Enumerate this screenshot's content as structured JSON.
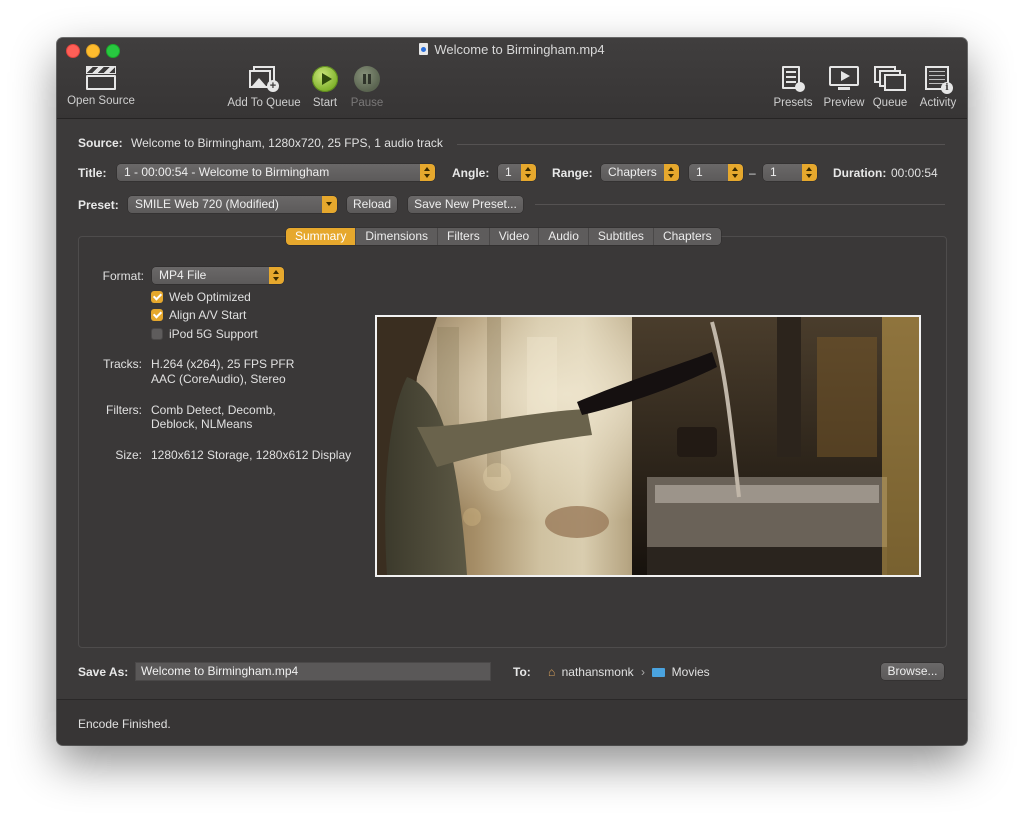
{
  "window": {
    "title": "Welcome to Birmingham.mp4"
  },
  "toolbar": {
    "open_source": "Open Source",
    "add_to_queue": "Add To Queue",
    "start": "Start",
    "pause": "Pause",
    "presets": "Presets",
    "preview": "Preview",
    "queue": "Queue",
    "activity": "Activity"
  },
  "source": {
    "label": "Source:",
    "value": "Welcome to Birmingham, 1280x720, 25 FPS, 1 audio track"
  },
  "title_row": {
    "title_label": "Title:",
    "title_value": "1 - 00:00:54 - Welcome to Birmingham",
    "angle_label": "Angle:",
    "angle_value": "1",
    "range_label": "Range:",
    "range_type": "Chapters",
    "range_start": "1",
    "range_dash": "–",
    "range_end": "1",
    "duration_label": "Duration:",
    "duration_value": "00:00:54"
  },
  "preset_row": {
    "label": "Preset:",
    "value": "SMILE Web 720 (Modified)",
    "reload": "Reload",
    "save_new": "Save New Preset..."
  },
  "tabs": [
    {
      "label": "Summary",
      "active": true
    },
    {
      "label": "Dimensions"
    },
    {
      "label": "Filters"
    },
    {
      "label": "Video"
    },
    {
      "label": "Audio"
    },
    {
      "label": "Subtitles"
    },
    {
      "label": "Chapters"
    }
  ],
  "summary": {
    "format_label": "Format:",
    "format_value": "MP4 File",
    "checks": [
      {
        "label": "Web Optimized",
        "checked": true
      },
      {
        "label": "Align A/V Start",
        "checked": true
      },
      {
        "label": "iPod 5G Support",
        "checked": false
      }
    ],
    "tracks_label": "Tracks:",
    "tracks_line1": "H.264 (x264), 25 FPS PFR",
    "tracks_line2": "AAC (CoreAudio), Stereo",
    "filters_label": "Filters:",
    "filters_line1": "Comb Detect, Decomb,",
    "filters_line2": "Deblock, NLMeans",
    "size_label": "Size:",
    "size_value": "1280x612 Storage, 1280x612 Display"
  },
  "save": {
    "label": "Save As:",
    "filename": "Welcome to Birmingham.mp4",
    "to_label": "To:",
    "path_user": "nathansmonk",
    "path_sep": "›",
    "path_folder": "Movies",
    "browse": "Browse..."
  },
  "status": {
    "text": "Encode Finished."
  },
  "colors": {
    "accent": "#e6a82d",
    "window_bg": "#3c3a3a",
    "start_green": "#7fb12b"
  }
}
